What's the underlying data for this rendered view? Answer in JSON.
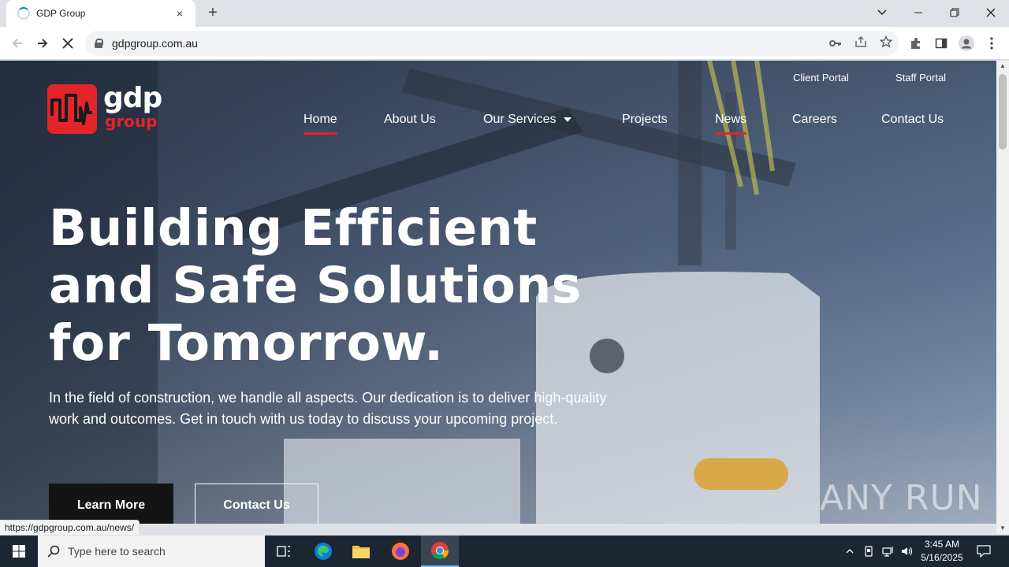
{
  "browser": {
    "tab_title": "GDP Group",
    "tab_close": "×",
    "new_tab": "+",
    "url": "gdpgroup.com.au",
    "status_url": "https://gdpgroup.com.au/news/",
    "icons": [
      "back-icon",
      "forward-icon",
      "stop-loading-icon",
      "lock-icon",
      "key-icon",
      "share-icon",
      "star-icon",
      "extensions-icon",
      "side-panel-icon",
      "profile-icon",
      "menu-icon"
    ]
  },
  "site": {
    "logo": {
      "word": "gdp",
      "sub": "group"
    },
    "portals": {
      "client": "Client Portal",
      "staff": "Staff Portal"
    },
    "nav": {
      "home": "Home",
      "about": "About Us",
      "services": "Our Services",
      "projects": "Projects",
      "news": "News",
      "careers": "Careers",
      "contact": "Contact Us"
    },
    "hero": {
      "line1": "Building Efficient",
      "line2": "and Safe Solutions",
      "line3": "for Tomorrow.",
      "text": "In the field of construction, we handle all aspects. Our dedication is to deliver high-quality work and outcomes. Get in touch with us today to discuss your upcoming project.",
      "primary_button": "Learn More",
      "secondary_button": "Contact Us"
    },
    "watermark": "ANY RUN",
    "colors": {
      "brand_red": "#e3252a",
      "button_dark": "#141414"
    }
  },
  "taskbar": {
    "search_placeholder": "Type here to search",
    "time": "3:45 AM",
    "date": "5/16/2025"
  }
}
